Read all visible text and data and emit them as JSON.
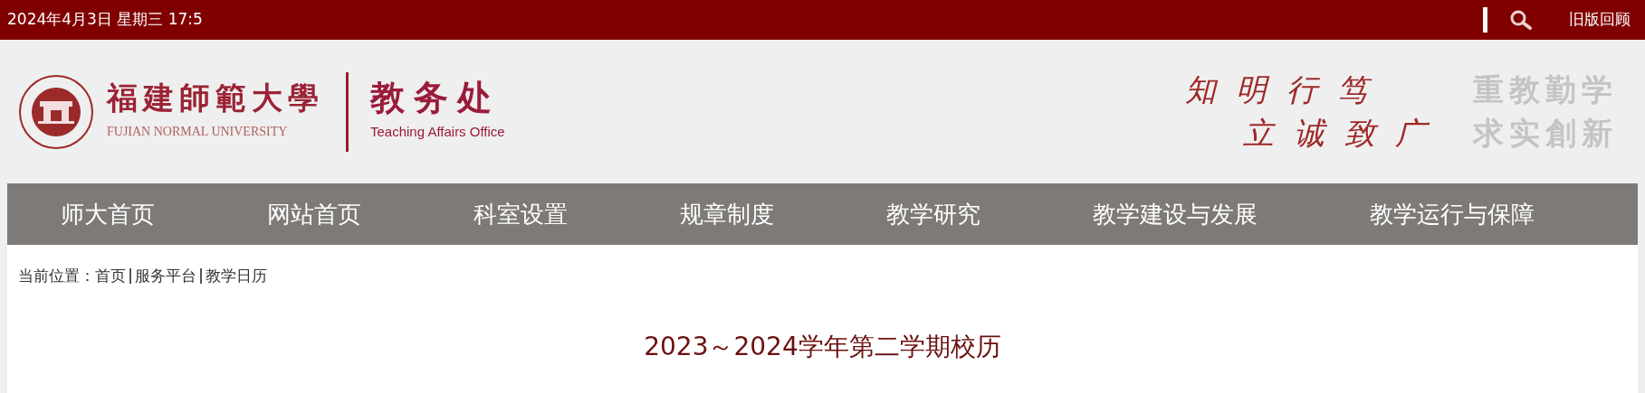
{
  "top_bar": {
    "datetime": "2024年4月3日 星期三 17:5",
    "old_version_link": "旧版回顾"
  },
  "header": {
    "university_name": "福建師範大學",
    "university_name_en": "FUJIAN NORMAL UNIVERSITY",
    "office_name": "教务处",
    "office_name_en": "Teaching Affairs Office",
    "motto_lines": [
      "知明行笃",
      "立诚致广"
    ],
    "motto_gray_lines": [
      "重教勤学",
      "求实創新"
    ]
  },
  "nav": {
    "items": [
      "师大首页",
      "网站首页",
      "科室设置",
      "规章制度",
      "教学研究",
      "教学建设与发展",
      "教学运行与保障"
    ]
  },
  "breadcrumb": {
    "label": "当前位置：",
    "items": [
      "首页",
      "服务平台",
      "教学日历"
    ]
  },
  "page_title": "2023～2024学年第二学期校历"
}
